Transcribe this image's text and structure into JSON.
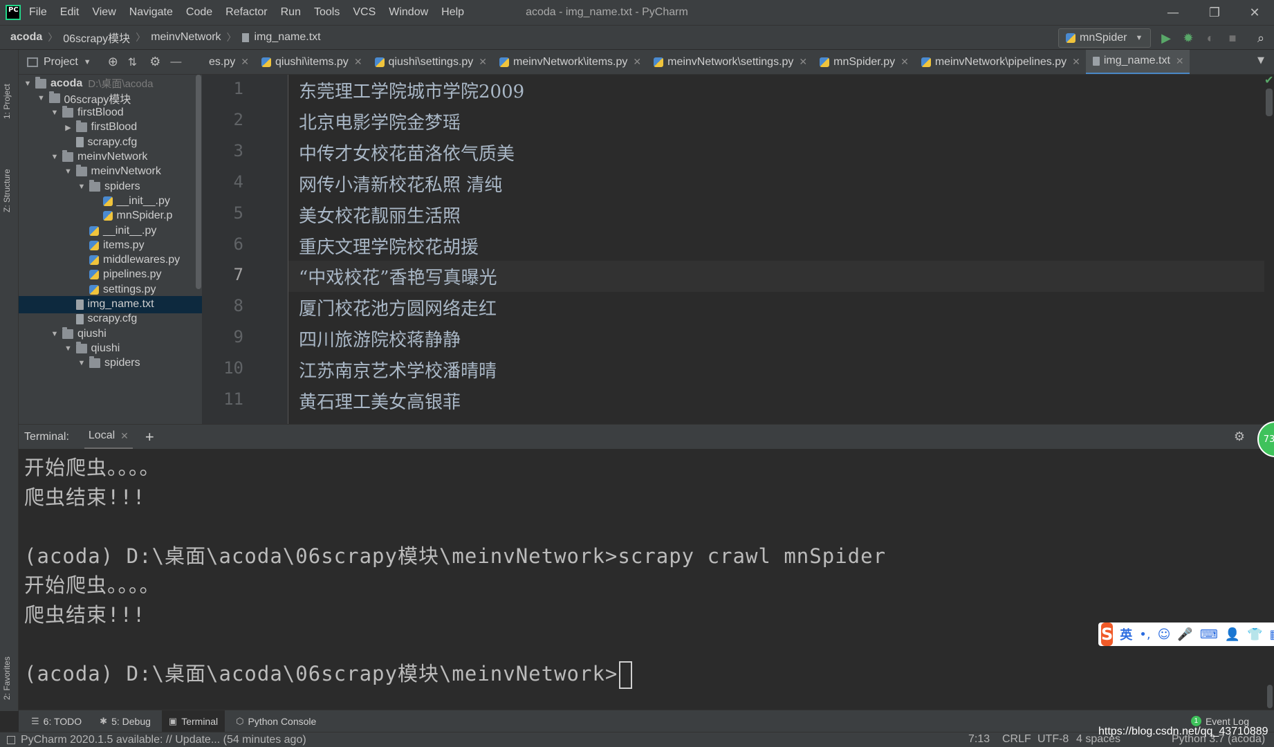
{
  "app": {
    "window_title": "acoda - img_name.txt - PyCharm",
    "logo_text": "PC"
  },
  "menu": [
    "File",
    "Edit",
    "View",
    "Navigate",
    "Code",
    "Refactor",
    "Run",
    "Tools",
    "VCS",
    "Window",
    "Help"
  ],
  "breadcrumb": [
    "acoda",
    "06scrapy模块",
    "meinvNetwork",
    "img_name.txt"
  ],
  "run_config": "mnSpider",
  "left_strip": {
    "project_tab": "1: Project",
    "structure_tab": "Z: Structure",
    "favorites_tab": "2: Favorites"
  },
  "project_panel": {
    "title": "Project",
    "tree": [
      {
        "label": "acoda",
        "hint": "D:\\桌面\\acoda",
        "arrow": "▼",
        "kind": "folder",
        "depth": 0
      },
      {
        "label": "06scrapy模块",
        "arrow": "▼",
        "kind": "folder",
        "depth": 1
      },
      {
        "label": "firstBlood",
        "arrow": "▼",
        "kind": "folder",
        "depth": 2
      },
      {
        "label": "firstBlood",
        "arrow": "▶",
        "kind": "folder",
        "depth": 3
      },
      {
        "label": "scrapy.cfg",
        "arrow": "",
        "kind": "txt",
        "depth": 3
      },
      {
        "label": "meinvNetwork",
        "arrow": "▼",
        "kind": "folder",
        "depth": 2
      },
      {
        "label": "meinvNetwork",
        "arrow": "▼",
        "kind": "folder",
        "depth": 3
      },
      {
        "label": "spiders",
        "arrow": "▼",
        "kind": "folder",
        "depth": 4
      },
      {
        "label": "__init__.py",
        "arrow": "",
        "kind": "py",
        "depth": 5
      },
      {
        "label": "mnSpider.p",
        "arrow": "",
        "kind": "py",
        "depth": 5
      },
      {
        "label": "__init__.py",
        "arrow": "",
        "kind": "py",
        "depth": 4
      },
      {
        "label": "items.py",
        "arrow": "",
        "kind": "py",
        "depth": 4
      },
      {
        "label": "middlewares.py",
        "arrow": "",
        "kind": "py",
        "depth": 4
      },
      {
        "label": "pipelines.py",
        "arrow": "",
        "kind": "py",
        "depth": 4
      },
      {
        "label": "settings.py",
        "arrow": "",
        "kind": "py",
        "depth": 4
      },
      {
        "label": "img_name.txt",
        "arrow": "",
        "kind": "txt",
        "depth": 3,
        "selected": true
      },
      {
        "label": "scrapy.cfg",
        "arrow": "",
        "kind": "txt",
        "depth": 3
      },
      {
        "label": "qiushi",
        "arrow": "▼",
        "kind": "folder",
        "depth": 2
      },
      {
        "label": "qiushi",
        "arrow": "▼",
        "kind": "folder",
        "depth": 3
      },
      {
        "label": "spiders",
        "arrow": "▼",
        "kind": "folder",
        "depth": 4
      }
    ]
  },
  "editor_tabs": [
    {
      "label": "es.py",
      "active": false
    },
    {
      "label": "qiushi\\items.py",
      "active": false
    },
    {
      "label": "qiushi\\settings.py",
      "active": false
    },
    {
      "label": "meinvNetwork\\items.py",
      "active": false
    },
    {
      "label": "meinvNetwork\\settings.py",
      "active": false
    },
    {
      "label": "mnSpider.py",
      "active": false
    },
    {
      "label": "meinvNetwork\\pipelines.py",
      "active": false
    },
    {
      "label": "img_name.txt",
      "active": true
    }
  ],
  "editor": {
    "current_line": 7,
    "lines": [
      "东莞理工学院城市学院2009",
      "北京电影学院金梦瑶",
      "中传才女校花苗洛依气质美",
      "网传小清新校花私照 清纯",
      "美女校花靓丽生活照",
      "重庆文理学院校花胡援",
      "“中戏校花”香艳写真曝光",
      "厦门校花池方圆网络走红",
      "四川旅游院校蒋静静",
      "江苏南京艺术学校潘晴晴",
      "黄石理工美女高银菲"
    ]
  },
  "terminal": {
    "title": "Terminal:",
    "tab": "Local",
    "lines": [
      "开始爬虫。。。。",
      "爬虫结束!!!",
      "",
      "(acoda) D:\\桌面\\acoda\\06scrapy模块\\meinvNetwork>scrapy crawl mnSpider",
      "开始爬虫。。。。",
      "爬虫结束!!!",
      "",
      "(acoda) D:\\桌面\\acoda\\06scrapy模块\\meinvNetwork>"
    ]
  },
  "ime": {
    "logo": "S",
    "mode": "英",
    "items": [
      "•,",
      "☺",
      "🎤",
      "⌨",
      "👤",
      "👕",
      "▦"
    ]
  },
  "badge": "73",
  "bottom_tools": [
    {
      "label": "6: TODO",
      "icon": "☰",
      "active": false
    },
    {
      "label": "5: Debug",
      "icon": "✱",
      "active": false
    },
    {
      "label": "Terminal",
      "icon": "▣",
      "active": true
    },
    {
      "label": "Python Console",
      "icon": "⬡",
      "active": false
    }
  ],
  "event_log": {
    "label": "Event Log",
    "count": "1"
  },
  "status": {
    "message": "PyCharm 2020.1.5 available: // Update... (54 minutes ago)",
    "position": "7:13",
    "line_sep": "CRLF",
    "encoding": "UTF-8",
    "indent": "4 spaces",
    "interpreter": "Python 3.7 (acoda)"
  },
  "watermark": "https://blog.csdn.net/qq_43710889"
}
